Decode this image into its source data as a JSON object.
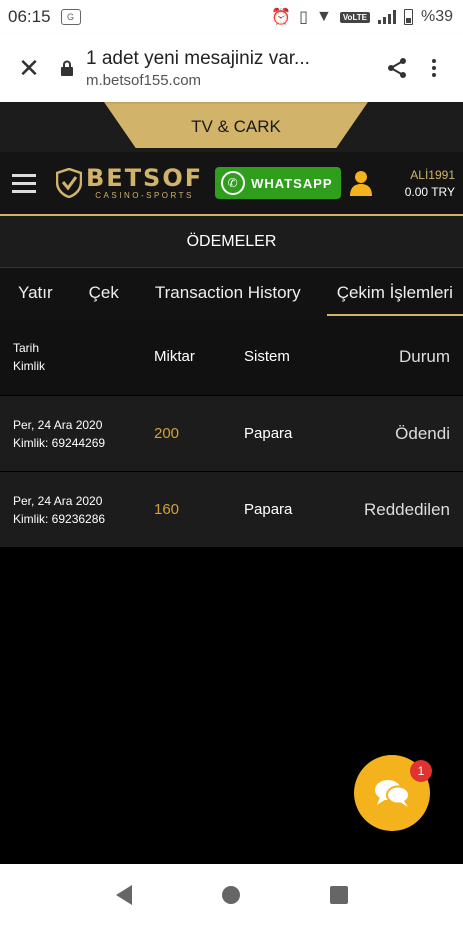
{
  "status_bar": {
    "time": "06:15",
    "battery_text": "%39",
    "volte": "VoLTE"
  },
  "browser": {
    "title": "1 adet yeni mesajiniz var...",
    "domain": "m.betsof155.com"
  },
  "site": {
    "top_tab": "TV & CARK",
    "logo": {
      "main": "BETSOF",
      "sub": "CASINO-SPORTS"
    },
    "whatsapp_label": "WHATSAPP",
    "user": {
      "name": "ALİ1991",
      "balance": "0.00 TRY"
    },
    "section_title": "ÖDEMELER",
    "tabs": [
      {
        "label": "Yatır"
      },
      {
        "label": "Çek"
      },
      {
        "label": "Transaction History"
      },
      {
        "label": "Çekim İşlemleri"
      }
    ],
    "table": {
      "headers": {
        "date": "Tarih",
        "id": "Kimlik",
        "amount": "Miktar",
        "system": "Sistem",
        "status": "Durum"
      },
      "rows": [
        {
          "date": "Per, 24 Ara 2020",
          "id": "Kimlik: 69244269",
          "amount": "200",
          "system": "Papara",
          "status": "Ödendi"
        },
        {
          "date": "Per, 24 Ara 2020",
          "id": "Kimlik: 69236286",
          "amount": "160",
          "system": "Papara",
          "status": "Reddedilen"
        }
      ]
    }
  },
  "chat": {
    "badge_count": "1"
  },
  "colors": {
    "gold": "#d2b36a",
    "whatsapp_green": "#2f9e1c",
    "chat_yellow": "#f4b31c",
    "badge_red": "#e0322e"
  }
}
